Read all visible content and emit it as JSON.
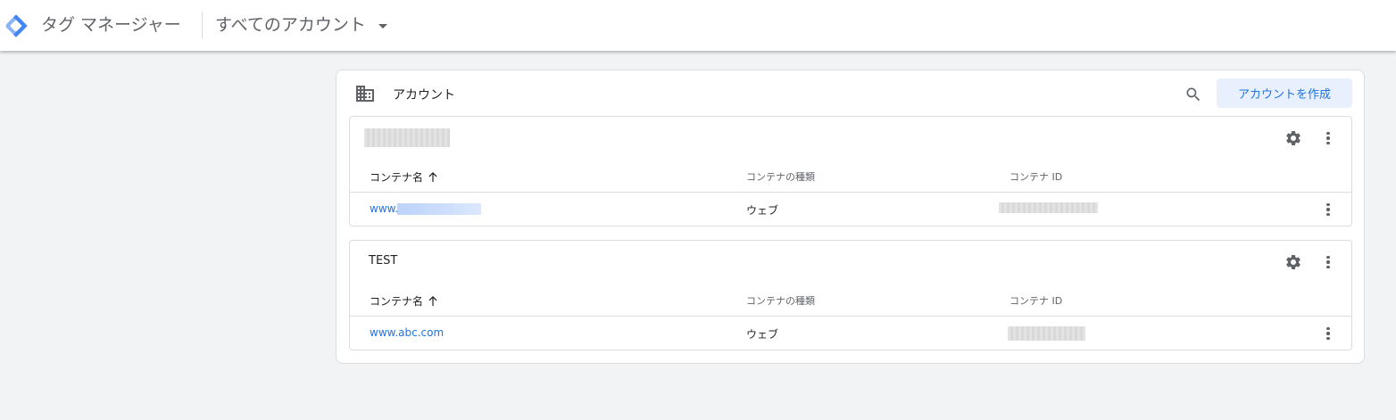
{
  "header": {
    "app_title": "タグ マネージャー",
    "account_switcher": "すべてのアカウント"
  },
  "colors": {
    "accent": "#1a73e8",
    "button_bg": "#e8f0fe",
    "background": "#f1f3f4"
  },
  "panel": {
    "title": "アカウント",
    "create_button": "アカウントを作成"
  },
  "accounts": [
    {
      "name": "",
      "columns": {
        "name": "コンテナ名",
        "type": "コンテナの種類",
        "id": "コンテナ ID"
      },
      "containers": [
        {
          "name": "www.s",
          "type": "ウェブ",
          "id": ""
        }
      ]
    },
    {
      "name": "TEST",
      "columns": {
        "name": "コンテナ名",
        "type": "コンテナの種類",
        "id": "コンテナ ID"
      },
      "containers": [
        {
          "name": "www.abc.com",
          "type": "ウェブ",
          "id": ""
        }
      ]
    }
  ]
}
